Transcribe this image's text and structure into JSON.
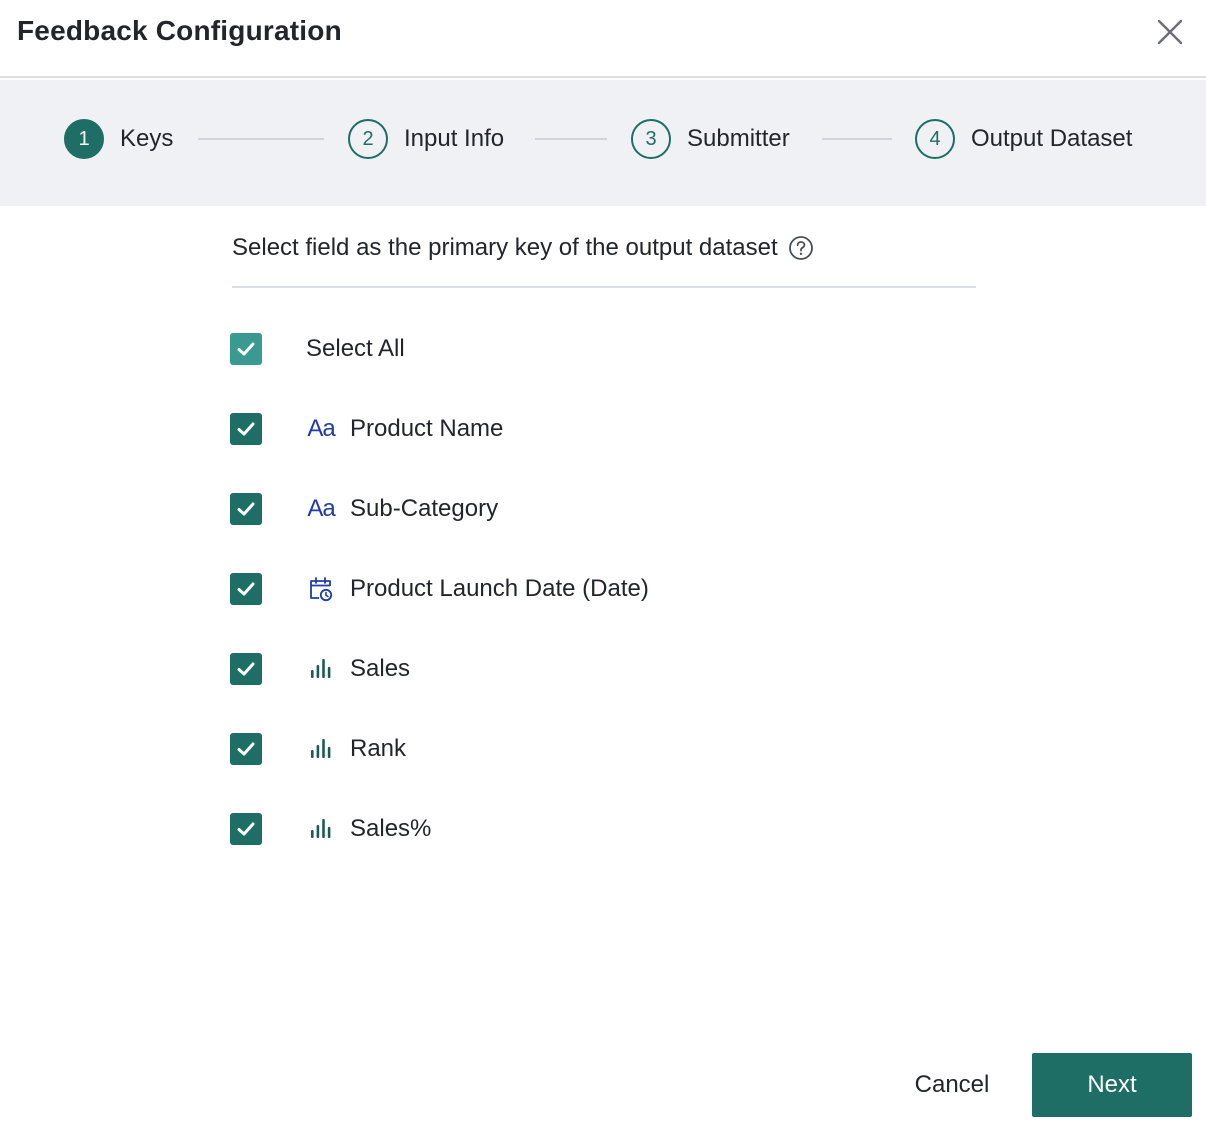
{
  "dialog": {
    "title": "Feedback Configuration",
    "close_icon": "close-icon"
  },
  "stepper": {
    "steps": [
      {
        "number": "1",
        "label": "Keys",
        "active": true
      },
      {
        "number": "2",
        "label": "Input Info",
        "active": false
      },
      {
        "number": "3",
        "label": "Submitter",
        "active": false
      },
      {
        "number": "4",
        "label": "Output Dataset",
        "active": false
      }
    ]
  },
  "content": {
    "instruction": "Select field as the primary key of the output dataset",
    "help_icon": "question-circle-icon",
    "select_all_label": "Select All",
    "fields": [
      {
        "label": "Product Name",
        "type_icon": "text-type-icon",
        "type_text": "Aa",
        "checked": true
      },
      {
        "label": "Sub-Category",
        "type_icon": "text-type-icon",
        "type_text": "Aa",
        "checked": true
      },
      {
        "label": "Product Launch Date (Date)",
        "type_icon": "date-type-icon",
        "checked": true
      },
      {
        "label": "Sales",
        "type_icon": "measure-bar-icon",
        "checked": true
      },
      {
        "label": "Rank",
        "type_icon": "measure-bar-icon",
        "checked": true
      },
      {
        "label": "Sales%",
        "type_icon": "measure-bar-icon",
        "checked": true
      }
    ]
  },
  "footer": {
    "cancel_label": "Cancel",
    "next_label": "Next"
  },
  "colors": {
    "accent": "#1e6e66",
    "select_all_check": "#3a9990",
    "text_type_icon": "#1f3ca8",
    "date_type_icon": "#1f3ca8",
    "measure_icon": "#1e5a52",
    "stepper_bg": "#eff1f5"
  }
}
